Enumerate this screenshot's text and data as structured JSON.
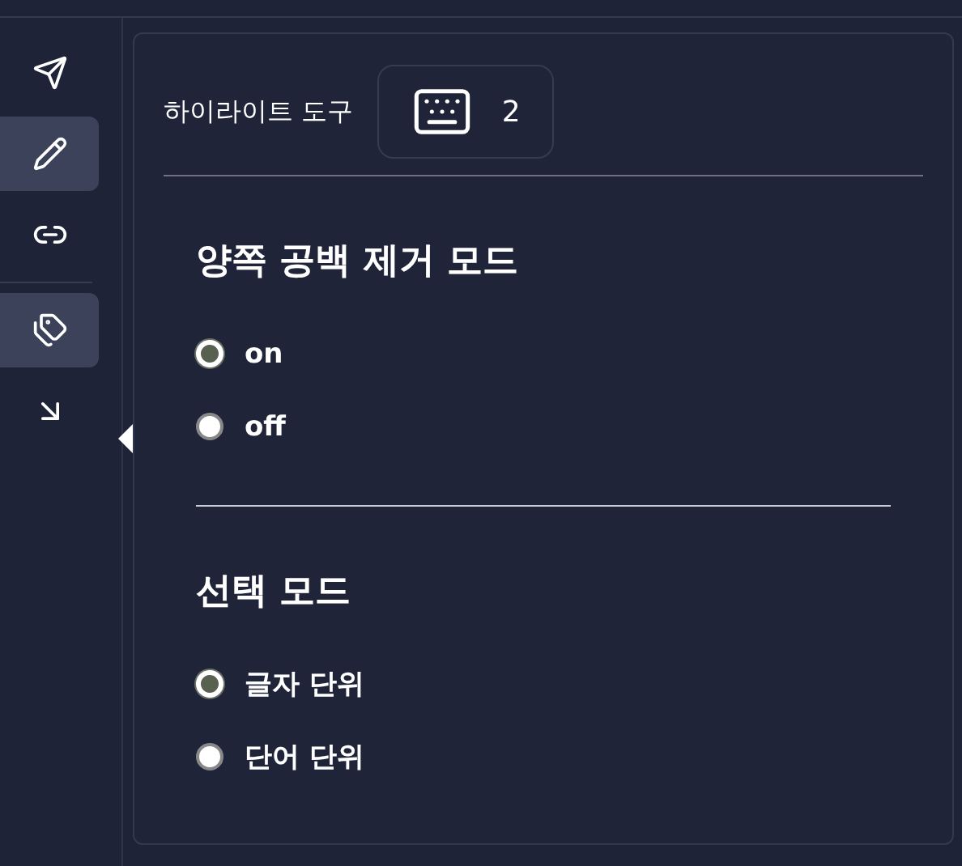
{
  "sidebar": {
    "groups": [
      [
        {
          "kind": "send",
          "selected": false
        },
        {
          "kind": "pencil",
          "selected": true
        },
        {
          "kind": "link",
          "selected": false
        }
      ],
      [
        {
          "kind": "tag",
          "selected": true
        },
        {
          "kind": "arrow",
          "selected": false
        }
      ]
    ]
  },
  "panel": {
    "title": "하이라이트 도구",
    "shortcut": "2",
    "sections": [
      {
        "title": "양쪽 공백 제거 모드",
        "options": [
          {
            "label": "on",
            "selected": true
          },
          {
            "label": "off",
            "selected": false
          }
        ]
      },
      {
        "title": "선택 모드",
        "options": [
          {
            "label": "글자 단위",
            "selected": true
          },
          {
            "label": "단어 단위",
            "selected": false
          }
        ]
      }
    ]
  }
}
